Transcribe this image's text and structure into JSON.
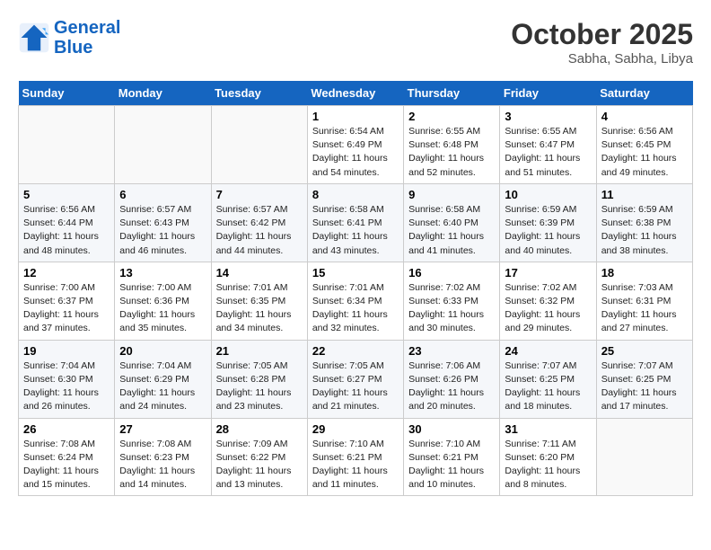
{
  "header": {
    "logo_line1": "General",
    "logo_line2": "Blue",
    "month": "October 2025",
    "location": "Sabha, Sabha, Libya"
  },
  "days_of_week": [
    "Sunday",
    "Monday",
    "Tuesday",
    "Wednesday",
    "Thursday",
    "Friday",
    "Saturday"
  ],
  "weeks": [
    [
      {
        "day": "",
        "sunrise": "",
        "sunset": "",
        "daylight": ""
      },
      {
        "day": "",
        "sunrise": "",
        "sunset": "",
        "daylight": ""
      },
      {
        "day": "",
        "sunrise": "",
        "sunset": "",
        "daylight": ""
      },
      {
        "day": "1",
        "sunrise": "Sunrise: 6:54 AM",
        "sunset": "Sunset: 6:49 PM",
        "daylight": "Daylight: 11 hours and 54 minutes."
      },
      {
        "day": "2",
        "sunrise": "Sunrise: 6:55 AM",
        "sunset": "Sunset: 6:48 PM",
        "daylight": "Daylight: 11 hours and 52 minutes."
      },
      {
        "day": "3",
        "sunrise": "Sunrise: 6:55 AM",
        "sunset": "Sunset: 6:47 PM",
        "daylight": "Daylight: 11 hours and 51 minutes."
      },
      {
        "day": "4",
        "sunrise": "Sunrise: 6:56 AM",
        "sunset": "Sunset: 6:45 PM",
        "daylight": "Daylight: 11 hours and 49 minutes."
      }
    ],
    [
      {
        "day": "5",
        "sunrise": "Sunrise: 6:56 AM",
        "sunset": "Sunset: 6:44 PM",
        "daylight": "Daylight: 11 hours and 48 minutes."
      },
      {
        "day": "6",
        "sunrise": "Sunrise: 6:57 AM",
        "sunset": "Sunset: 6:43 PM",
        "daylight": "Daylight: 11 hours and 46 minutes."
      },
      {
        "day": "7",
        "sunrise": "Sunrise: 6:57 AM",
        "sunset": "Sunset: 6:42 PM",
        "daylight": "Daylight: 11 hours and 44 minutes."
      },
      {
        "day": "8",
        "sunrise": "Sunrise: 6:58 AM",
        "sunset": "Sunset: 6:41 PM",
        "daylight": "Daylight: 11 hours and 43 minutes."
      },
      {
        "day": "9",
        "sunrise": "Sunrise: 6:58 AM",
        "sunset": "Sunset: 6:40 PM",
        "daylight": "Daylight: 11 hours and 41 minutes."
      },
      {
        "day": "10",
        "sunrise": "Sunrise: 6:59 AM",
        "sunset": "Sunset: 6:39 PM",
        "daylight": "Daylight: 11 hours and 40 minutes."
      },
      {
        "day": "11",
        "sunrise": "Sunrise: 6:59 AM",
        "sunset": "Sunset: 6:38 PM",
        "daylight": "Daylight: 11 hours and 38 minutes."
      }
    ],
    [
      {
        "day": "12",
        "sunrise": "Sunrise: 7:00 AM",
        "sunset": "Sunset: 6:37 PM",
        "daylight": "Daylight: 11 hours and 37 minutes."
      },
      {
        "day": "13",
        "sunrise": "Sunrise: 7:00 AM",
        "sunset": "Sunset: 6:36 PM",
        "daylight": "Daylight: 11 hours and 35 minutes."
      },
      {
        "day": "14",
        "sunrise": "Sunrise: 7:01 AM",
        "sunset": "Sunset: 6:35 PM",
        "daylight": "Daylight: 11 hours and 34 minutes."
      },
      {
        "day": "15",
        "sunrise": "Sunrise: 7:01 AM",
        "sunset": "Sunset: 6:34 PM",
        "daylight": "Daylight: 11 hours and 32 minutes."
      },
      {
        "day": "16",
        "sunrise": "Sunrise: 7:02 AM",
        "sunset": "Sunset: 6:33 PM",
        "daylight": "Daylight: 11 hours and 30 minutes."
      },
      {
        "day": "17",
        "sunrise": "Sunrise: 7:02 AM",
        "sunset": "Sunset: 6:32 PM",
        "daylight": "Daylight: 11 hours and 29 minutes."
      },
      {
        "day": "18",
        "sunrise": "Sunrise: 7:03 AM",
        "sunset": "Sunset: 6:31 PM",
        "daylight": "Daylight: 11 hours and 27 minutes."
      }
    ],
    [
      {
        "day": "19",
        "sunrise": "Sunrise: 7:04 AM",
        "sunset": "Sunset: 6:30 PM",
        "daylight": "Daylight: 11 hours and 26 minutes."
      },
      {
        "day": "20",
        "sunrise": "Sunrise: 7:04 AM",
        "sunset": "Sunset: 6:29 PM",
        "daylight": "Daylight: 11 hours and 24 minutes."
      },
      {
        "day": "21",
        "sunrise": "Sunrise: 7:05 AM",
        "sunset": "Sunset: 6:28 PM",
        "daylight": "Daylight: 11 hours and 23 minutes."
      },
      {
        "day": "22",
        "sunrise": "Sunrise: 7:05 AM",
        "sunset": "Sunset: 6:27 PM",
        "daylight": "Daylight: 11 hours and 21 minutes."
      },
      {
        "day": "23",
        "sunrise": "Sunrise: 7:06 AM",
        "sunset": "Sunset: 6:26 PM",
        "daylight": "Daylight: 11 hours and 20 minutes."
      },
      {
        "day": "24",
        "sunrise": "Sunrise: 7:07 AM",
        "sunset": "Sunset: 6:25 PM",
        "daylight": "Daylight: 11 hours and 18 minutes."
      },
      {
        "day": "25",
        "sunrise": "Sunrise: 7:07 AM",
        "sunset": "Sunset: 6:25 PM",
        "daylight": "Daylight: 11 hours and 17 minutes."
      }
    ],
    [
      {
        "day": "26",
        "sunrise": "Sunrise: 7:08 AM",
        "sunset": "Sunset: 6:24 PM",
        "daylight": "Daylight: 11 hours and 15 minutes."
      },
      {
        "day": "27",
        "sunrise": "Sunrise: 7:08 AM",
        "sunset": "Sunset: 6:23 PM",
        "daylight": "Daylight: 11 hours and 14 minutes."
      },
      {
        "day": "28",
        "sunrise": "Sunrise: 7:09 AM",
        "sunset": "Sunset: 6:22 PM",
        "daylight": "Daylight: 11 hours and 13 minutes."
      },
      {
        "day": "29",
        "sunrise": "Sunrise: 7:10 AM",
        "sunset": "Sunset: 6:21 PM",
        "daylight": "Daylight: 11 hours and 11 minutes."
      },
      {
        "day": "30",
        "sunrise": "Sunrise: 7:10 AM",
        "sunset": "Sunset: 6:21 PM",
        "daylight": "Daylight: 11 hours and 10 minutes."
      },
      {
        "day": "31",
        "sunrise": "Sunrise: 7:11 AM",
        "sunset": "Sunset: 6:20 PM",
        "daylight": "Daylight: 11 hours and 8 minutes."
      },
      {
        "day": "",
        "sunrise": "",
        "sunset": "",
        "daylight": ""
      }
    ]
  ]
}
